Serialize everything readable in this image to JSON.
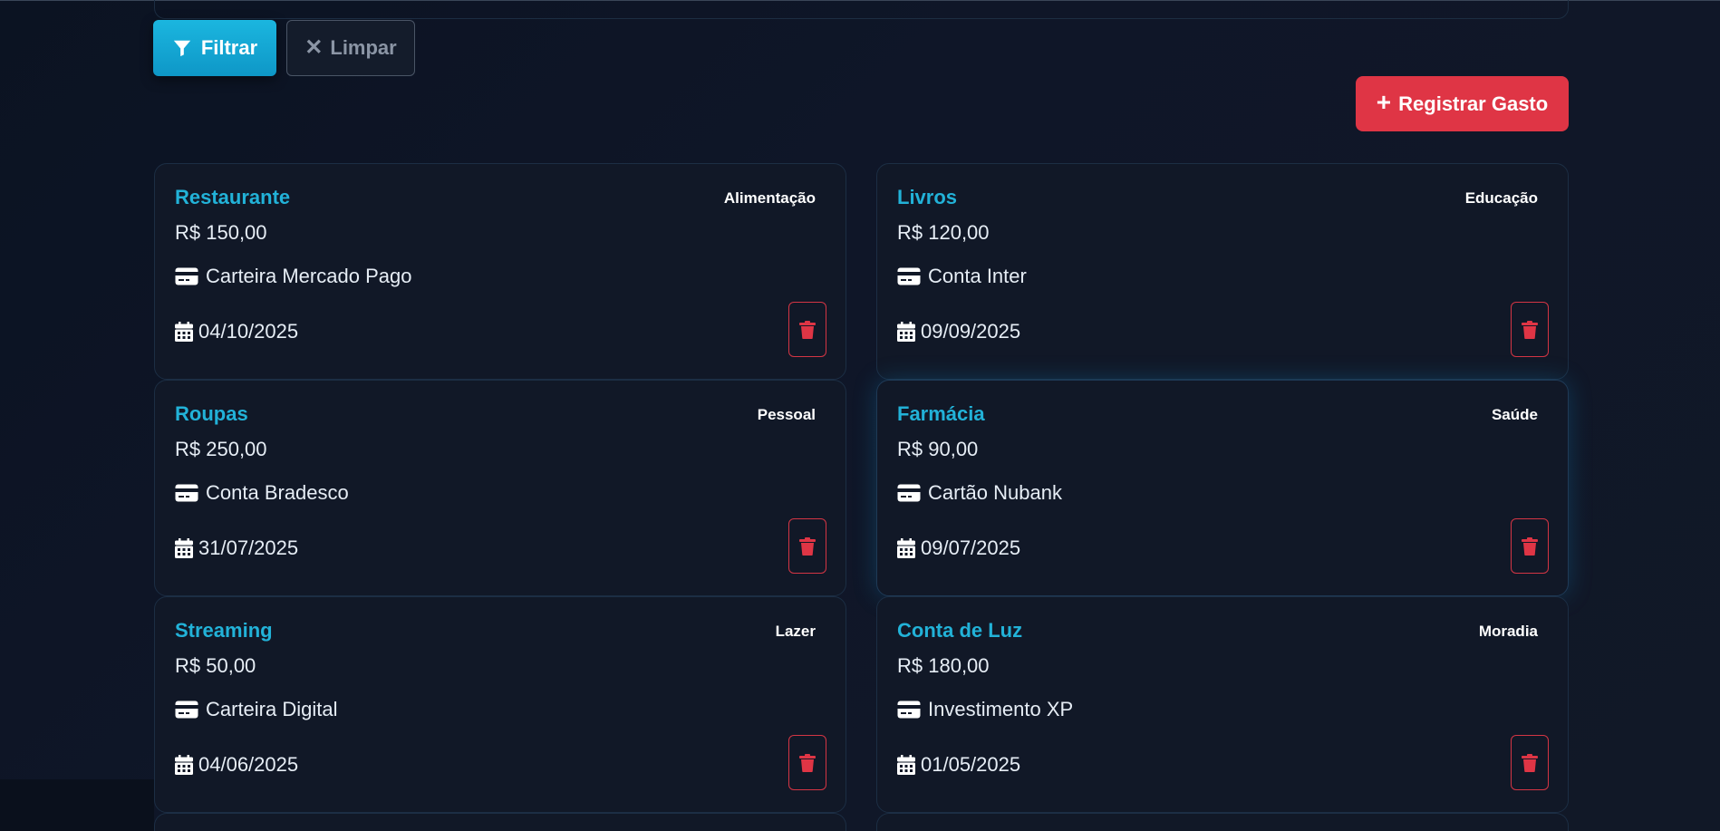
{
  "toolbar": {
    "filter_label": "Filtrar",
    "clear_label": "Limpar",
    "register_label": "Registrar Gasto"
  },
  "colors": {
    "accent": "#22b2d8",
    "filter_button": "#12a9d6",
    "danger": "#df3545",
    "background": "#0f1628"
  },
  "expenses": [
    {
      "title": "Restaurante",
      "category": "Alimentação",
      "amount": "R$ 150,00",
      "account": "Carteira Mercado Pago",
      "date": "04/10/2025"
    },
    {
      "title": "Livros",
      "category": "Educação",
      "amount": "R$ 120,00",
      "account": "Conta Inter",
      "date": "09/09/2025"
    },
    {
      "title": "Roupas",
      "category": "Pessoal",
      "amount": "R$ 250,00",
      "account": "Conta Bradesco",
      "date": "31/07/2025"
    },
    {
      "title": "Farmácia",
      "category": "Saúde",
      "amount": "R$ 90,00",
      "account": "Cartão Nubank",
      "date": "09/07/2025"
    },
    {
      "title": "Streaming",
      "category": "Lazer",
      "amount": "R$ 50,00",
      "account": "Carteira Digital",
      "date": "04/06/2025"
    },
    {
      "title": "Conta de Luz",
      "category": "Moradia",
      "amount": "R$ 180,00",
      "account": "Investimento XP",
      "date": "01/05/2025"
    }
  ],
  "icons": {
    "filter": "filter-icon",
    "clear": "close-icon",
    "register": "plus-icon",
    "account": "credit-card-icon",
    "date": "calendar-icon",
    "delete": "trash-icon"
  }
}
